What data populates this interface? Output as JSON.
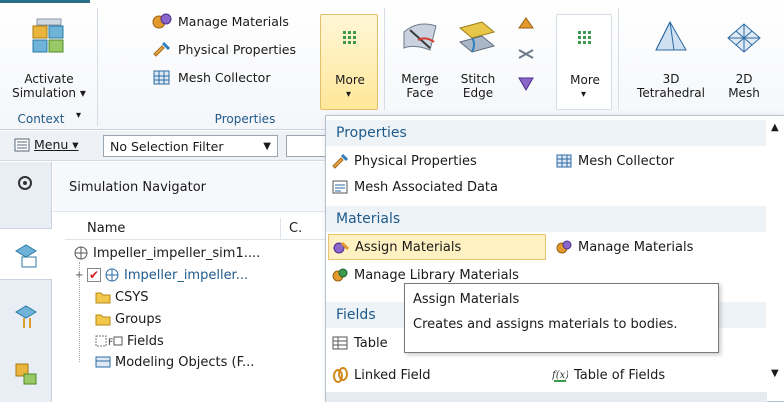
{
  "ribbon": {
    "context": {
      "activate_line1": "Activate",
      "activate_line2": "Simulation ▾",
      "group_label": "Context"
    },
    "properties": {
      "manage_materials": "Manage Materials",
      "physical_properties": "Physical Properties",
      "mesh_collector": "Mesh Collector",
      "group_label": "Properties",
      "more_label": "More"
    },
    "edges": {
      "merge_line1": "Merge",
      "merge_line2": "Face",
      "stitch_line1": "Stitch",
      "stitch_line2": "Edge",
      "more_label": "More"
    },
    "mesh": {
      "tet_line1": "3D",
      "tet_line2": "Tetrahedral",
      "mesh2d_line1": "2D",
      "mesh2d_line2": "Mesh"
    }
  },
  "toolbar": {
    "menu_label": "Menu ▾",
    "selection_filter": "No Selection Filter"
  },
  "navigator": {
    "title": "Simulation Navigator",
    "columns": [
      "Name",
      "C."
    ],
    "rows": [
      {
        "label": "Impeller_impeller_sim1...."
      },
      {
        "label": "Impeller_impeller..."
      },
      {
        "label": "CSYS"
      },
      {
        "label": "Groups"
      },
      {
        "label": "Fields"
      },
      {
        "label": "Modeling Objects (F..."
      }
    ]
  },
  "menu": {
    "sections": {
      "properties": "Properties",
      "materials": "Materials",
      "fields": "Fields"
    },
    "items": {
      "physical_properties": "Physical Properties",
      "mesh_collector": "Mesh Collector",
      "mesh_associated_data": "Mesh Associated Data",
      "assign_materials": "Assign Materials",
      "manage_materials": "Manage Materials",
      "manage_library_materials": "Manage Library Materials",
      "table": "Table",
      "linked_field": "Linked Field",
      "table_of_fields": "Table of Fields"
    }
  },
  "tooltip": {
    "title": "Assign Materials",
    "description": "Creates and assigns materials to bodies."
  },
  "colors": {
    "accent_blue": "#1f5a8a",
    "highlight_yellow": "#fff1c2",
    "checkbox_red": "#d11f1f"
  },
  "icons": [
    "activate-simulation-icon",
    "manage-materials-icon",
    "physical-properties-icon",
    "mesh-collector-icon",
    "more-icon",
    "merge-face-icon",
    "stitch-edge-icon",
    "tetrahedral-icon",
    "mesh-2d-icon",
    "settings-icon",
    "assign-materials-icon",
    "field-table-icon",
    "linked-field-icon",
    "table-of-fields-icon"
  ]
}
